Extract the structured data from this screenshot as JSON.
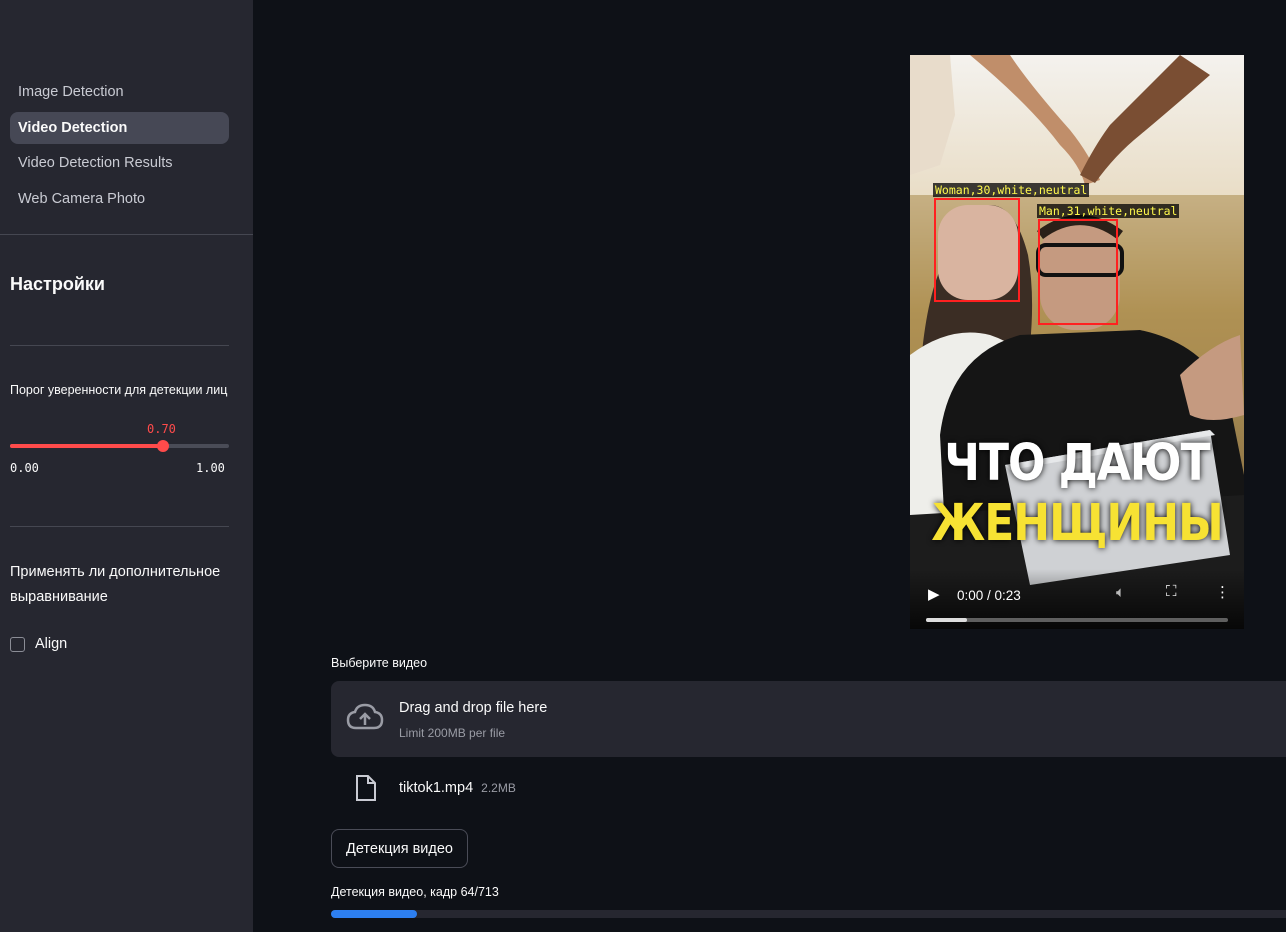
{
  "sidebar": {
    "nav": [
      {
        "label": "Image Detection",
        "active": false
      },
      {
        "label": "Video Detection",
        "active": true
      },
      {
        "label": "Video Detection Results",
        "active": false
      },
      {
        "label": "Web Camera Photo",
        "active": false
      }
    ],
    "settings_title": "Настройки",
    "slider": {
      "label": "Порог уверенности для детекции лиц",
      "value": 0.7,
      "value_text": "0.70",
      "min_text": "0.00",
      "max_text": "1.00"
    },
    "align_question": "Применять ли дополнительное выравнивание",
    "align_checkbox": {
      "label": "Align",
      "checked": false
    }
  },
  "video": {
    "detections": [
      {
        "label": "Woman,30,white,neutral"
      },
      {
        "label": "Man,31,white,neutral"
      }
    ],
    "overlay_line1": "ЧТО ДАЮТ",
    "overlay_line2": "ЖЕНЩИНЫ",
    "time": "0:00 / 0:23",
    "progress": 0.135
  },
  "uploader": {
    "label": "Выберите видео",
    "title": "Drag and drop file here",
    "subtitle": "Limit 200MB per file",
    "file_name": "tiktok1.mp4",
    "file_size": "2.2MB"
  },
  "detect_button": "Детекция видео",
  "progress": {
    "text": "Детекция видео, кадр 64/713",
    "current": 64,
    "total": 713
  },
  "colors": {
    "accent": "#ff4b4b",
    "progress": "#2d7ff0",
    "background": "#0e1117",
    "sidebar": "#262730"
  }
}
